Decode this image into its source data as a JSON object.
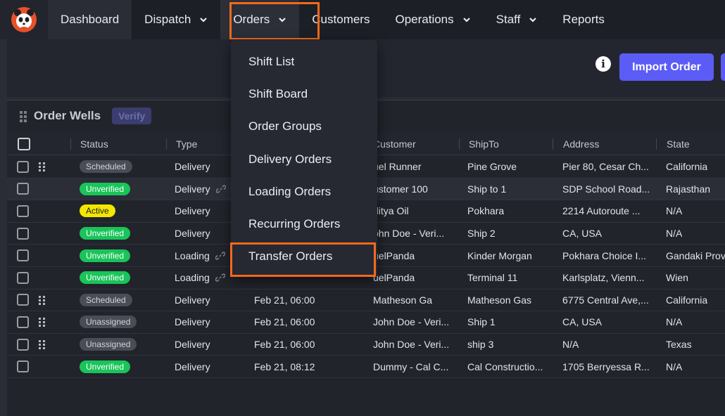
{
  "nav": {
    "logo_icon": "panda-logo-icon",
    "items": [
      {
        "label": "Dashboard",
        "has_dropdown": false
      },
      {
        "label": "Dispatch",
        "has_dropdown": true
      },
      {
        "label": "Orders",
        "has_dropdown": true
      },
      {
        "label": "Customers",
        "has_dropdown": false
      },
      {
        "label": "Operations",
        "has_dropdown": true
      },
      {
        "label": "Staff",
        "has_dropdown": true
      },
      {
        "label": "Reports",
        "has_dropdown": false
      }
    ]
  },
  "toolbar": {
    "info_icon": "info-icon",
    "import_label": "Import Order"
  },
  "panel": {
    "title": "Order Wells",
    "verify_label": "Verify"
  },
  "orders_menu": {
    "items": [
      "Shift List",
      "Shift Board",
      "Order Groups",
      "Delivery Orders",
      "Loading Orders",
      "Recurring Orders",
      "Transfer Orders"
    ]
  },
  "table": {
    "columns": [
      "Status",
      "Type",
      "Customer",
      "ShipTo",
      "Address",
      "State"
    ],
    "rows": [
      {
        "grip": true,
        "status": "Scheduled",
        "type": "Delivery",
        "link": false,
        "date": "",
        "customer": "uel Runner",
        "shipto": "Pine Grove",
        "address": "Pier 80, Cesar Ch...",
        "state": "California"
      },
      {
        "grip": false,
        "status": "Unverified",
        "type": "Delivery",
        "link": true,
        "date": "",
        "customer": "ustomer 100",
        "shipto": "Ship to 1",
        "address": "SDP School Road...",
        "state": "Rajasthan"
      },
      {
        "grip": false,
        "status": "Active",
        "type": "Delivery",
        "link": false,
        "date": "",
        "customer": "ditya Oil",
        "shipto": "Pokhara",
        "address": "2214 Autoroute ...",
        "state": "N/A"
      },
      {
        "grip": false,
        "status": "Unverified",
        "type": "Delivery",
        "link": false,
        "date": "",
        "customer": "ohn Doe - Veri...",
        "shipto": "Ship 2",
        "address": "CA, USA",
        "state": "N/A"
      },
      {
        "grip": false,
        "status": "Unverified",
        "type": "Loading",
        "link": true,
        "date": "",
        "customer": "uelPanda",
        "shipto": "Kinder Morgan",
        "address": "Pokhara Choice I...",
        "state": "Gandaki Prov"
      },
      {
        "grip": false,
        "status": "Unverified",
        "type": "Loading",
        "link": true,
        "date": "",
        "customer": "uelPanda",
        "shipto": "Terminal 11",
        "address": "Karlsplatz, Vienn...",
        "state": "Wien"
      },
      {
        "grip": true,
        "status": "Scheduled",
        "type": "Delivery",
        "link": false,
        "date": "Feb 21, 06:00",
        "customer": "Matheson Ga",
        "shipto": "Matheson Gas",
        "address": "6775 Central Ave,...",
        "state": "California"
      },
      {
        "grip": true,
        "status": "Unassigned",
        "type": "Delivery",
        "link": false,
        "date": "Feb 21, 06:00",
        "customer": "John Doe - Veri...",
        "shipto": "Ship 1",
        "address": "CA, USA",
        "state": "N/A"
      },
      {
        "grip": true,
        "status": "Unassigned",
        "type": "Delivery",
        "link": false,
        "date": "Feb 21, 06:00",
        "customer": "John Doe - Veri...",
        "shipto": "ship 3",
        "address": "N/A",
        "state": "Texas"
      },
      {
        "grip": false,
        "status": "Unverified",
        "type": "Delivery",
        "link": false,
        "date": "Feb 21, 08:12",
        "customer": "Dummy - Cal C...",
        "shipto": "Cal Constructio...",
        "address": "1705 Berryessa R...",
        "state": "N/A"
      }
    ]
  },
  "colors": {
    "accent": "#5b5cf6",
    "highlight": "#f26a1b",
    "unverified": "#19c459",
    "active": "#f3e600"
  }
}
